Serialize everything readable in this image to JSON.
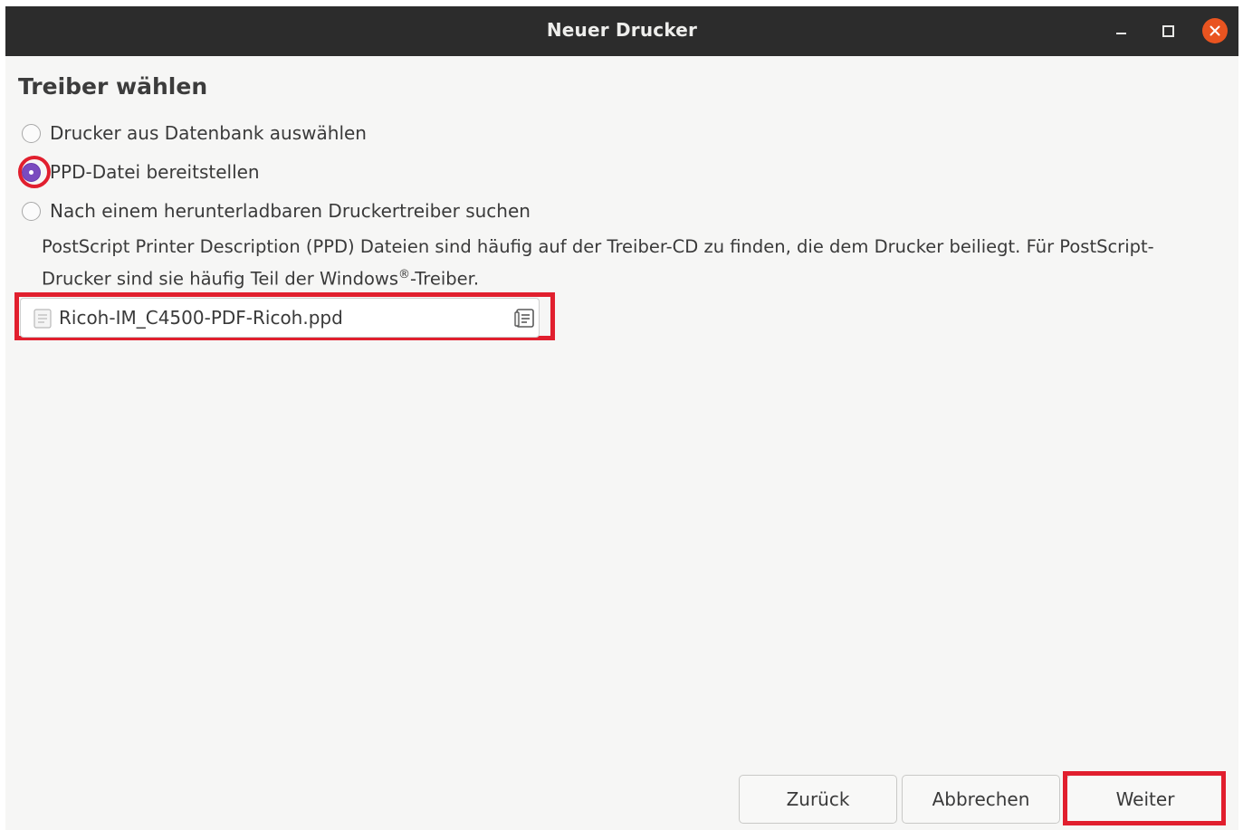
{
  "window": {
    "title": "Neuer Drucker"
  },
  "heading": "Treiber wählen",
  "options": [
    {
      "label": "Drucker aus Datenbank auswählen",
      "checked": false
    },
    {
      "label": "PPD-Datei bereitstellen",
      "checked": true
    },
    {
      "label": "Nach einem herunterladbaren Druckertreiber suchen",
      "checked": false
    }
  ],
  "description": {
    "part1": "PostScript Printer Description (PPD) Dateien sind häufig auf der Treiber-CD zu finden, die dem Drucker beiliegt. Für PostScript-Drucker sind sie häufig Teil der Windows",
    "sup": "®",
    "part2": "-Treiber."
  },
  "file_chooser": {
    "value": "Ricoh-IM_C4500-PDF-Ricoh.ppd"
  },
  "buttons": {
    "back": "Zurück",
    "cancel": "Abbrechen",
    "next": "Weiter"
  },
  "colors": {
    "titlebar": "#2c2c2c",
    "close_button": "#e95420",
    "radio_checked": "#7a4bbf",
    "highlight": "#e11f2e"
  },
  "icons": [
    "minimize-icon",
    "maximize-icon",
    "close-icon",
    "file-icon",
    "file-open-icon"
  ]
}
